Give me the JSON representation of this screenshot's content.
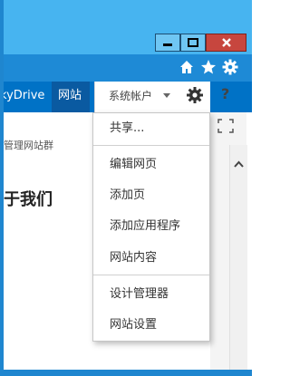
{
  "window": {
    "minimize_label": "minimize",
    "maximize_label": "maximize",
    "close_label": "close"
  },
  "toolbar": {
    "icons": [
      "home-icon",
      "star-icon",
      "gear-icon"
    ]
  },
  "suitebar": {
    "skydrive_label": "kyDrive",
    "site_label": "网站",
    "account_label": "系统帐户",
    "help_label": "?"
  },
  "page": {
    "breadcrumb_text": "管理网站群",
    "heading": "于我们"
  },
  "menu": {
    "groups": [
      [
        "共享..."
      ],
      [
        "编辑网页",
        "添加页",
        "添加应用程序",
        "网站内容"
      ],
      [
        "设计管理器",
        "网站设置"
      ]
    ]
  },
  "colors": {
    "titlebar": "#47b4f0",
    "toolbar": "#1e8ad6",
    "suitebar": "#0072c6",
    "close_button": "#c7463e"
  }
}
